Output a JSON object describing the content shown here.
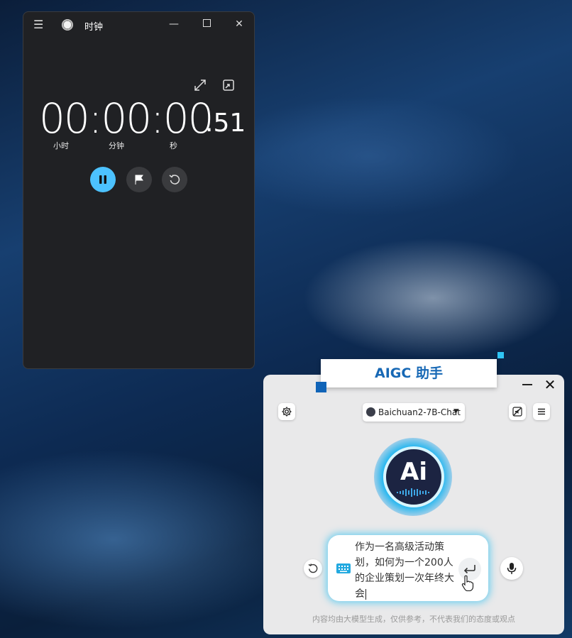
{
  "clock": {
    "title": "时钟",
    "time_main": "00:00:00",
    "time_fraction": ".51",
    "units": {
      "hours": "小时",
      "minutes": "分钟",
      "seconds": "秒"
    }
  },
  "assistant": {
    "tag_title": "AIGC 助手",
    "model_name": "Baichuan2-7B-Chat",
    "logo_text": "Ai",
    "input_text": "作为一名高级活动策划，如何为一个200人的企业策划一次年终大会",
    "disclaimer": "内容均由大模型生成，仅供参考，不代表我们的态度或观点",
    "colors": {
      "accent_blue": "#1768b5",
      "glow_cyan": "#2bb8ef",
      "pause_blue": "#4cc2ff"
    }
  }
}
